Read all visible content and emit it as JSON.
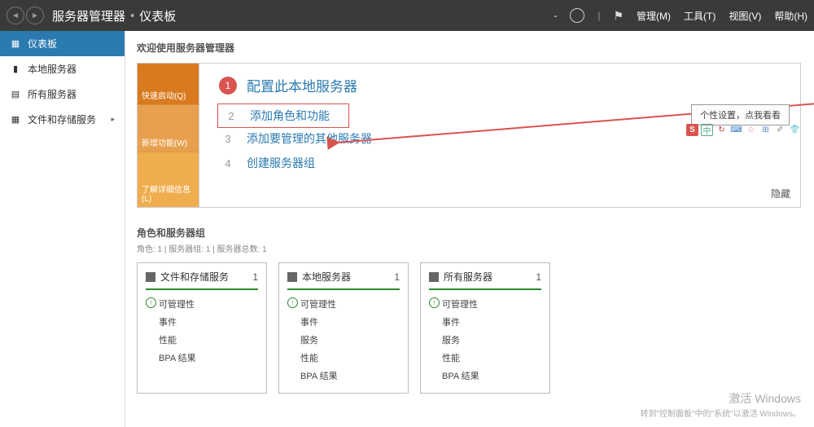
{
  "header": {
    "app_title": "服务器管理器",
    "page_title": "仪表板",
    "menu": {
      "manage": "管理(M)",
      "tools": "工具(T)",
      "view": "视图(V)",
      "help": "帮助(H)"
    }
  },
  "sidebar": {
    "items": [
      {
        "icon": "▦",
        "label": "仪表板"
      },
      {
        "icon": "▮",
        "label": "本地服务器"
      },
      {
        "icon": "▤",
        "label": "所有服务器"
      },
      {
        "icon": "▦",
        "label": "文件和存储服务"
      }
    ]
  },
  "welcome": {
    "title": "欢迎使用服务器管理器",
    "tabs": [
      {
        "label": "快速启动(Q)"
      },
      {
        "label": "新增功能(W)"
      },
      {
        "label": "了解详细信息(L)"
      }
    ],
    "tasks": [
      {
        "num": "1",
        "text": "配置此本地服务器",
        "primary": true
      },
      {
        "num": "2",
        "text": "添加角色和功能"
      },
      {
        "num": "3",
        "text": "添加要管理的其他服务器"
      },
      {
        "num": "4",
        "text": "创建服务器组"
      }
    ],
    "hide": "隐藏"
  },
  "tooltip": {
    "text": "个性设置，点我看看"
  },
  "ime": [
    "中",
    "↻",
    "⌨",
    "☺",
    "⊞",
    "✐",
    "👕"
  ],
  "groups": {
    "title": "角色和服务器组",
    "subtitle": "角色: 1 | 服务器组: 1 | 服务器总数: 1",
    "cards": [
      {
        "title": "文件和存储服务",
        "count": "1",
        "metrics": [
          "可管理性",
          "事件",
          "性能",
          "BPA 结果"
        ]
      },
      {
        "title": "本地服务器",
        "count": "1",
        "metrics": [
          "可管理性",
          "事件",
          "服务",
          "性能",
          "BPA 结果"
        ]
      },
      {
        "title": "所有服务器",
        "count": "1",
        "metrics": [
          "可管理性",
          "事件",
          "服务",
          "性能",
          "BPA 结果"
        ]
      }
    ]
  },
  "watermark": {
    "line1": "激活 Windows",
    "line2": "转到\"控制面板\"中的\"系统\"以激活 Windows。"
  }
}
